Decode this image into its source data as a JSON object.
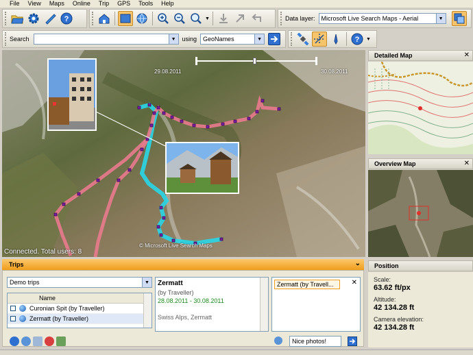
{
  "menu": [
    "File",
    "View",
    "Maps",
    "Online",
    "Trip",
    "GPS",
    "Tools",
    "Help"
  ],
  "toolbar": {
    "data_layer_label": "Data layer:",
    "data_layer_value": "Microsoft Live Search Maps - Aerial",
    "btn_2d": "2D",
    "btn_3d": "3D"
  },
  "search": {
    "label": "Search",
    "value": "",
    "using_label": "using",
    "provider": "GeoNames"
  },
  "map": {
    "date_start": "29.08.2011",
    "date_end": "30.08.2011",
    "status": "Connected.  Total users: 8",
    "copyright": "© Microsoft Live Search Maps"
  },
  "detailed_map": {
    "title": "Detailed Map"
  },
  "overview_map": {
    "title": "Overview Map"
  },
  "trips": {
    "title": "Trips",
    "dropdown": "Demo trips",
    "column_name": "Name",
    "items": [
      {
        "name": "Curonian Spit (by Traveller)"
      },
      {
        "name": "Zermatt (by Traveller)"
      }
    ],
    "detail": {
      "title": "Zermatt",
      "author": "(by Traveller)",
      "dates": "28.08.2011 - 30.08.2011",
      "location": "Swiss Alps, Zermatt"
    },
    "tab_label": "Zermatt (by Travell...",
    "comment_value": "Nice photos!"
  },
  "position": {
    "title": "Position",
    "scale_label": "Scale:",
    "scale_value": "63.62 ft/px",
    "altitude_label": "Altitude:",
    "altitude_value": "42 134.28 ft",
    "camera_label": "Camera elevation:",
    "camera_value": "42 134.28 ft"
  },
  "colors": {
    "accent": "#f19d1b",
    "track_pink": "#e97a8e",
    "track_cyan": "#29d6e8",
    "waypoint": "#7a1fa0"
  }
}
